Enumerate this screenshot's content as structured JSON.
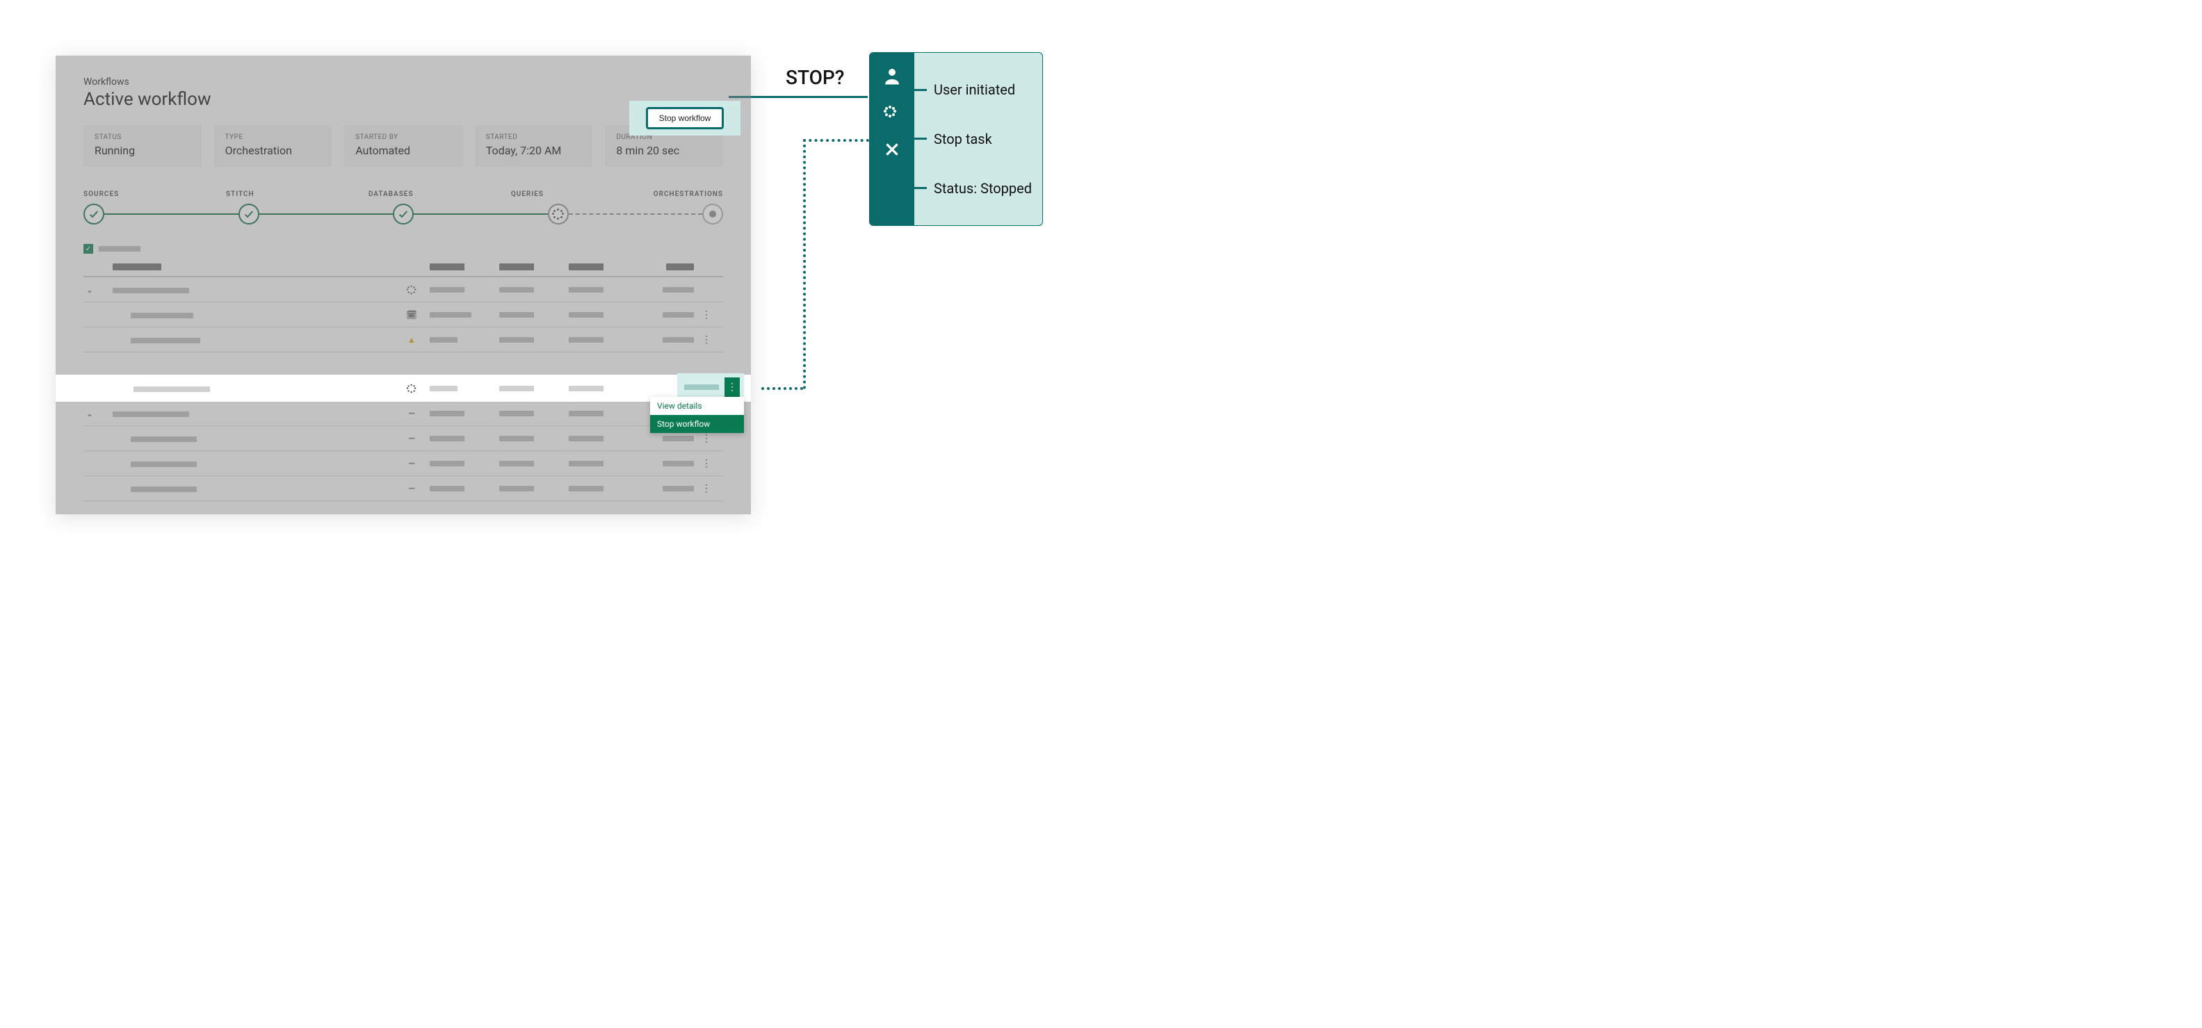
{
  "breadcrumb": "Workflows",
  "page_title": "Active workflow",
  "stop_button": "Stop workflow",
  "cards": {
    "status": {
      "label": "STATUS",
      "value": "Running"
    },
    "type": {
      "label": "TYPE",
      "value": "Orchestration"
    },
    "started_by": {
      "label": "STARTED BY",
      "value": "Automated"
    },
    "started": {
      "label": "STARTED",
      "value": "Today, 7:20 AM"
    },
    "duration": {
      "label": "DURATION",
      "value": "8 min 20 sec"
    }
  },
  "steps": {
    "sources": "SOURCES",
    "stitch": "STITCH",
    "databases": "DATABASES",
    "queries": "QUERIES",
    "orchestrations": "ORCHESTRATIONS"
  },
  "dropdown": {
    "view_details": "View details",
    "stop_workflow": "Stop workflow"
  },
  "annotation": {
    "stop_q": "STOP?",
    "user_initiated": "User initiated",
    "stop_task": "Stop task",
    "status_stopped": "Status: Stopped"
  }
}
